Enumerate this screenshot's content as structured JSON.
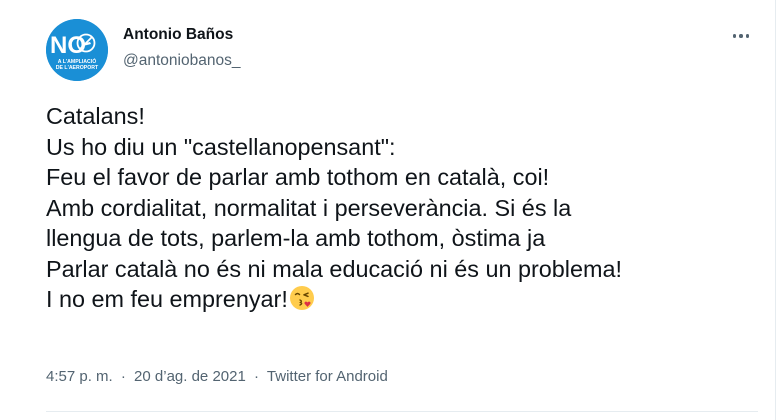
{
  "author": {
    "name": "Antonio Baños",
    "handle": "@antoniobanos_",
    "avatar": {
      "icon": "no-ampliacio-aeroport-logo",
      "big_text": "NO",
      "caption_line1": "A L'AMPLIACIÓ",
      "caption_line2": "DE L'AEROPORT",
      "background": "#1a8fd6"
    }
  },
  "more_icon": "more-horizontal-icon",
  "tweet": {
    "lines": [
      "Catalans!",
      "Us ho diu un \"castellanopensant\":",
      "Feu el favor de parlar amb tothom en català, coi!",
      "Amb cordialitat, normalitat i perseverància. Si és la",
      "llengua de tots, parlem-la amb tothom, òstima ja",
      "Parlar català no és ni mala educació ni és un problema!",
      "I no em feu emprenyar!"
    ],
    "emoji": "face-blowing-a-kiss-emoji"
  },
  "meta": {
    "time": "4:57 p. m.",
    "separator": "·",
    "date": "20 d’ag. de 2021",
    "source": "Twitter for Android"
  },
  "colors": {
    "text": "#0f1419",
    "secondary": "#536471",
    "divider": "#e6ecf0"
  }
}
